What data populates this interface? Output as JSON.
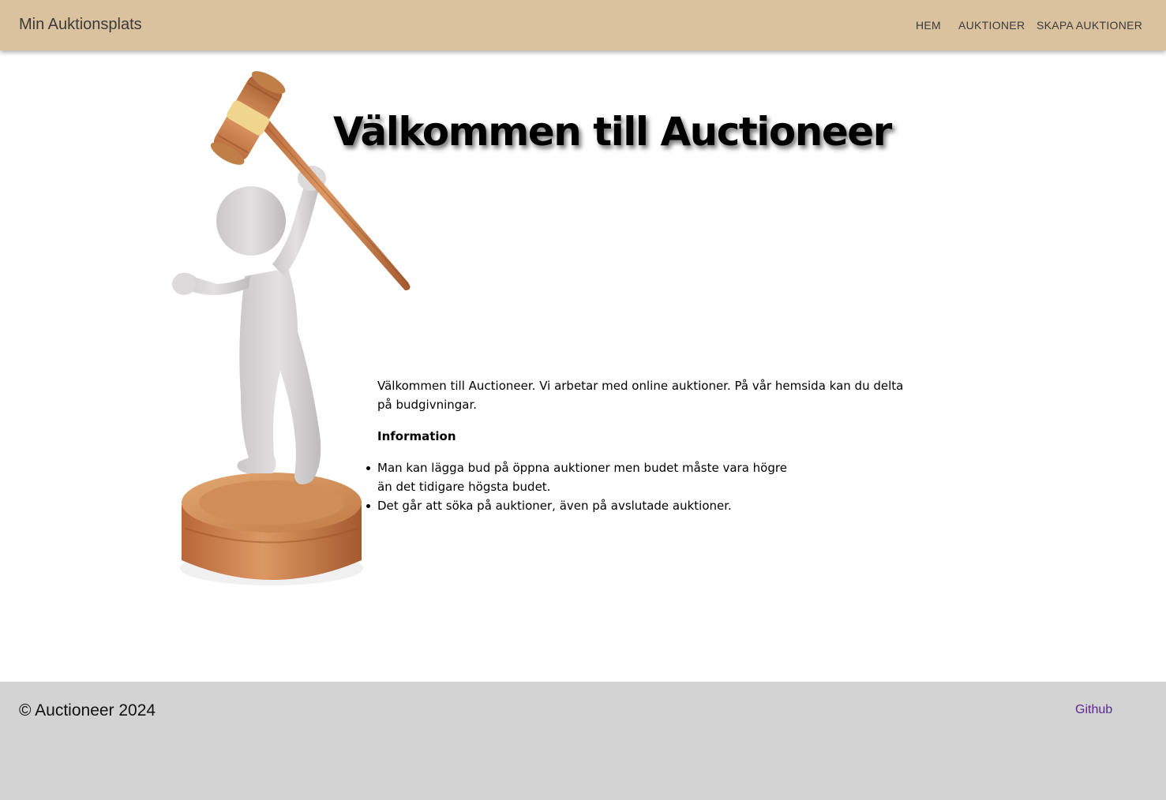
{
  "navbar": {
    "brand": "Min Auktionsplats",
    "links": [
      "HEM",
      "AUKTIONER",
      "SKAPA AUKTIONER"
    ],
    "background_color": "#dbc29f"
  },
  "hero": {
    "title": "Välkommen till Auctioneer",
    "image_icon": "gavel-figure-illustration"
  },
  "content": {
    "intro": "Välkommen till Auctioneer. Vi arbetar med online auktioner. På vår hemsida kan du delta på budgivningar.",
    "info_heading": "Information",
    "info_items": [
      "Man kan lägga bud på öppna auktioner men budet måste vara högre än det tidigare högsta budet.",
      "Det går att söka på auktioner, även på avslutade auktioner."
    ]
  },
  "footer": {
    "copyright": "© Auctioneer 2024",
    "github_label": "Github",
    "background_color": "#d3d3d3",
    "link_color": "#5b2a91"
  }
}
